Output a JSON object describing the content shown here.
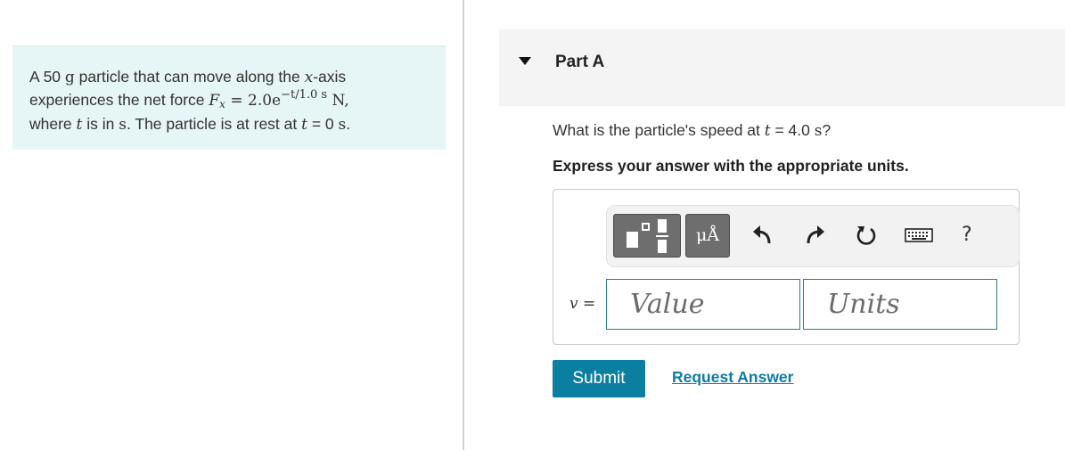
{
  "problem": {
    "line1_a": "A 50 ",
    "unit_g": "g",
    "line1_b": " particle that can move along the ",
    "var_x": "x",
    "line1_c": "-axis",
    "line2_a": "experiences the net force ",
    "force_F": "F",
    "force_sub": "x",
    "force_eq": " = 2.0e",
    "force_exp": "−t/1.0 s",
    "force_unit": " N,",
    "line3_a": "where ",
    "var_t": "t",
    "line3_b": " is in ",
    "unit_s": "s",
    "line3_c": ". The particle is at rest at ",
    "var_t2": "t",
    "line3_d": " = 0 ",
    "unit_s2": "s",
    "line3_e": "."
  },
  "part": {
    "title": "Part A"
  },
  "question": {
    "prefix": "What is the particle's speed at ",
    "var_t": "t",
    "value": " = 4.0 ",
    "unit": "s",
    "suffix": "?"
  },
  "instruction": "Express your answer with the appropriate units.",
  "toolbar": {
    "units_label": "μÅ",
    "help_label": "?"
  },
  "answer": {
    "variable_label": "v =",
    "value_placeholder": "Value",
    "units_placeholder": "Units"
  },
  "actions": {
    "submit_label": "Submit",
    "request_label": "Request Answer"
  },
  "colors": {
    "problem_bg": "#e6f5f5",
    "accent": "#0b7fa0",
    "link": "#0d7ca5",
    "field_border": "#2f7a91"
  }
}
